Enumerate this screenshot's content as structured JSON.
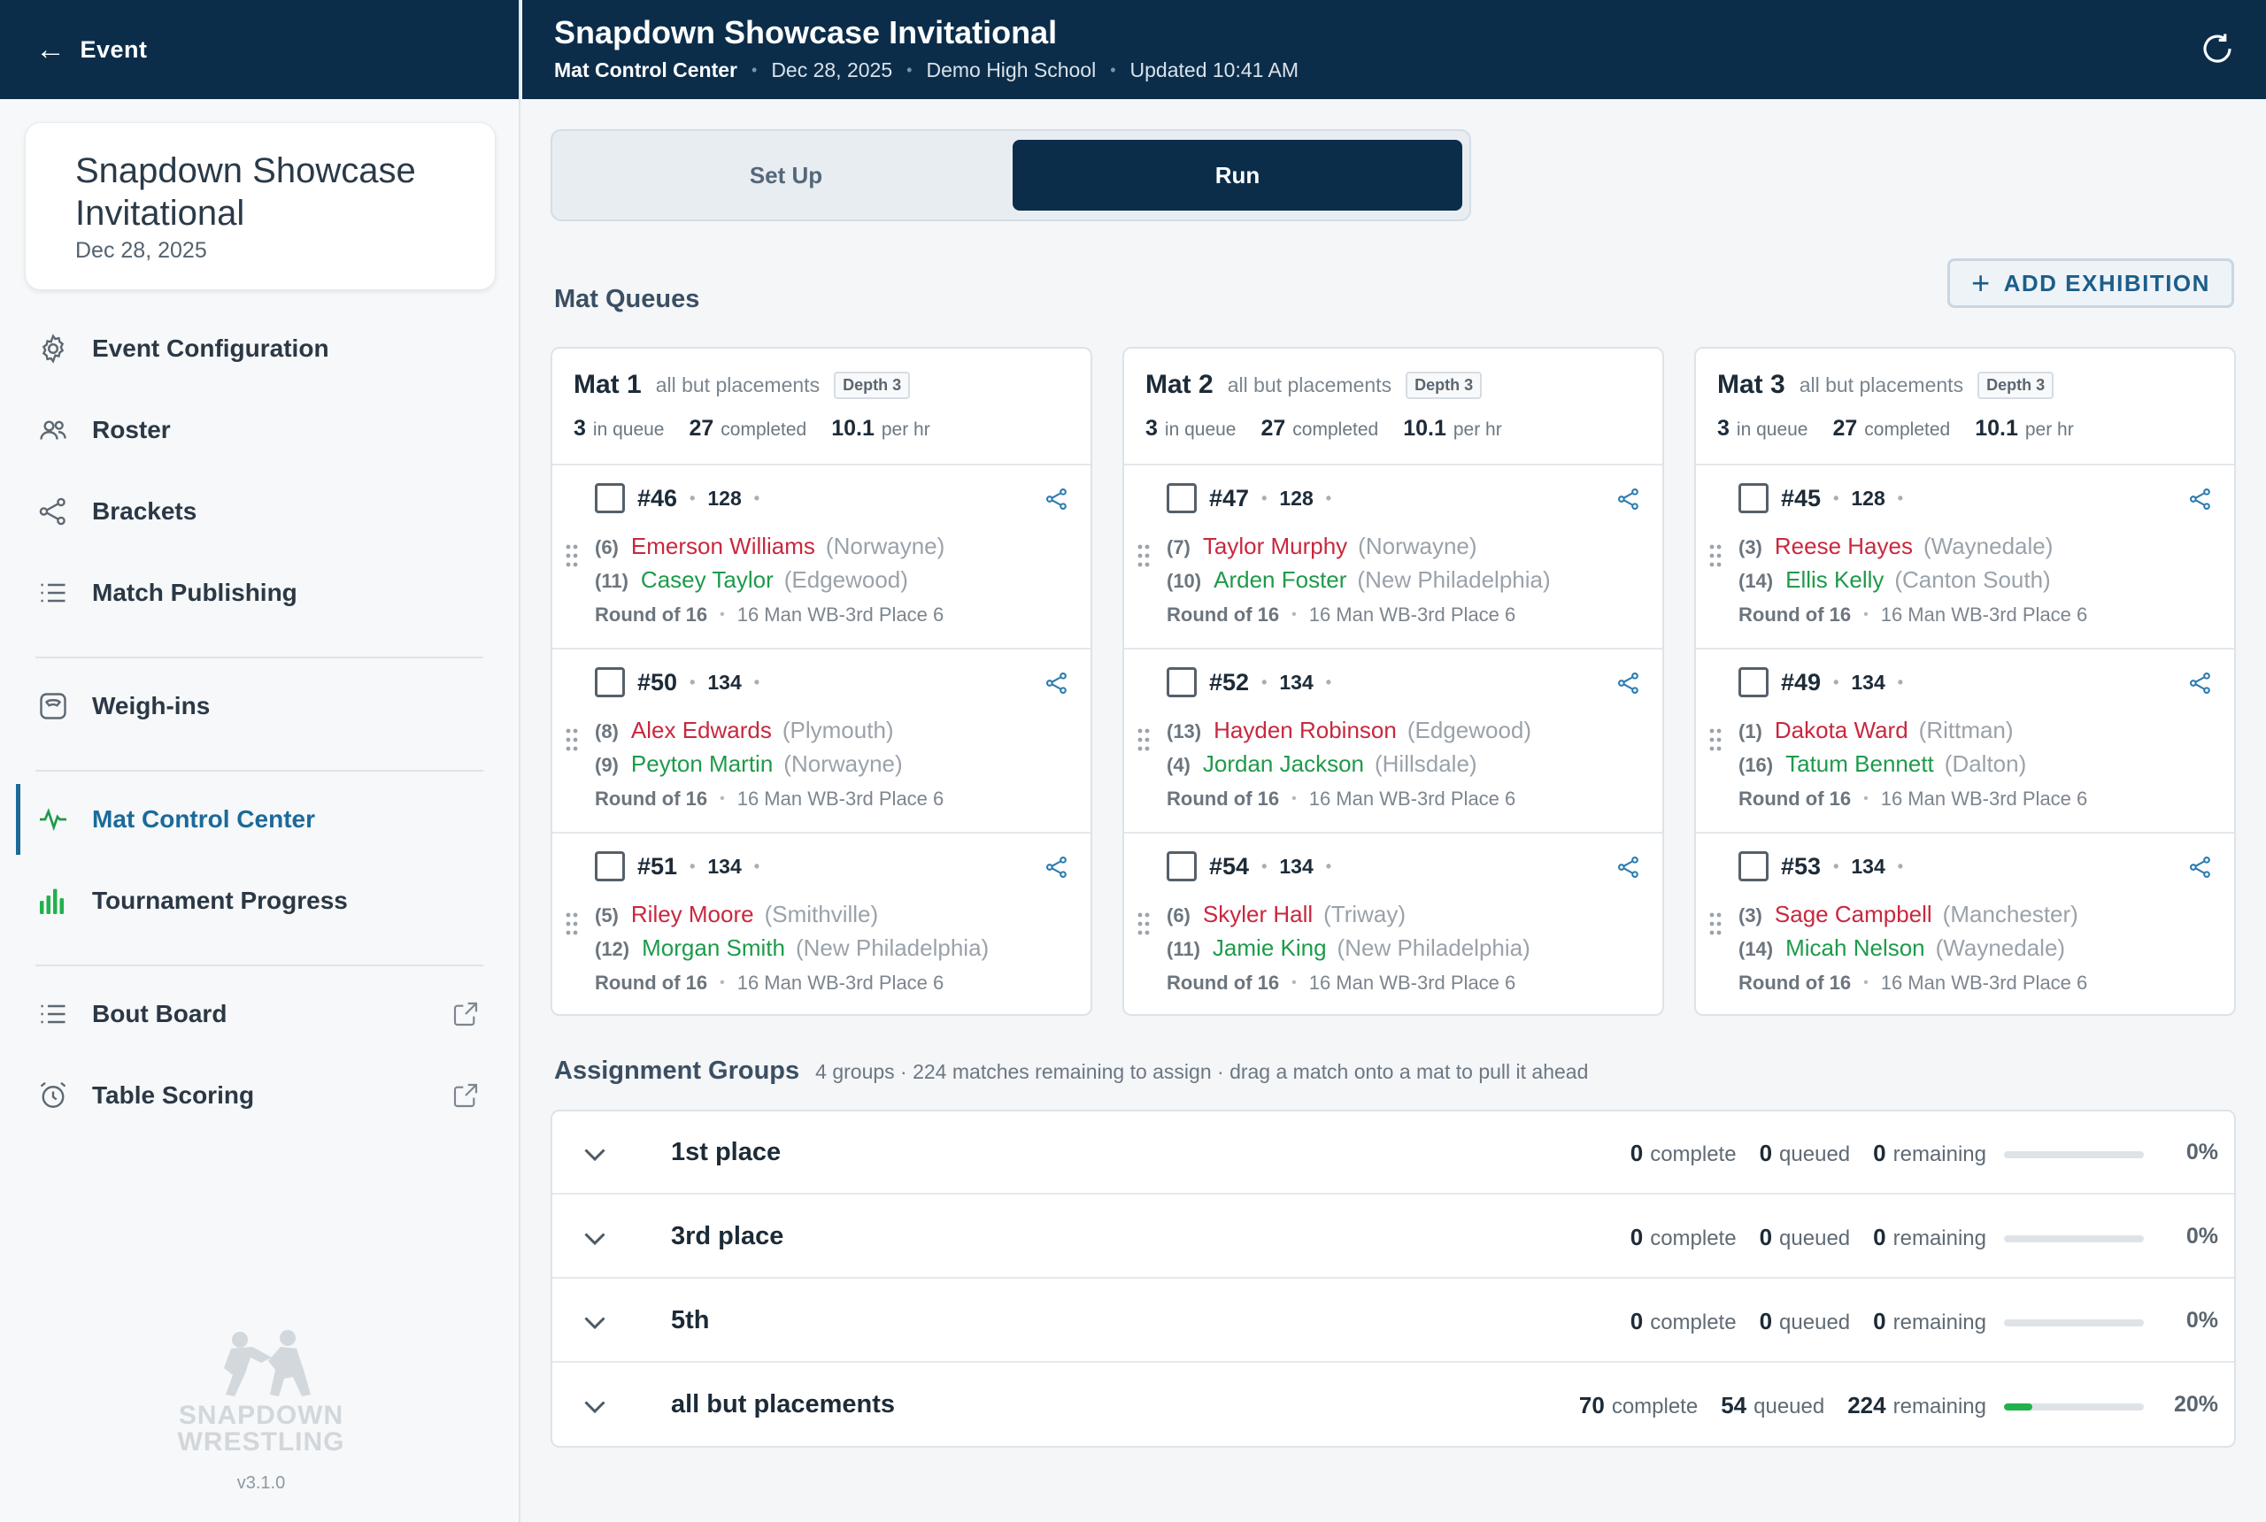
{
  "sidebar": {
    "back_label": "Event",
    "event_card": {
      "title": "Snapdown Showcase Invitational",
      "date": "Dec 28, 2025"
    },
    "items": [
      {
        "label": "Event Configuration",
        "icon": "gear-icon"
      },
      {
        "label": "Roster",
        "icon": "users-icon"
      },
      {
        "label": "Brackets",
        "icon": "share-nodes-icon"
      },
      {
        "label": "Match Publishing",
        "icon": "list-icon"
      },
      {
        "label": "Weigh-ins",
        "icon": "scale-icon"
      },
      {
        "label": "Mat Control Center",
        "icon": "pulse-icon",
        "active": true
      },
      {
        "label": "Tournament Progress",
        "icon": "bar-chart-icon"
      },
      {
        "label": "Bout Board",
        "icon": "list-icon",
        "external": true
      },
      {
        "label": "Table Scoring",
        "icon": "alarm-clock-icon",
        "external": true
      }
    ],
    "logo_line1": "SNAPDOWN",
    "logo_line2": "WRESTLING",
    "version": "v3.1.0"
  },
  "header": {
    "title": "Snapdown Showcase Invitational",
    "crumb": "Mat Control Center",
    "date": "Dec 28, 2025",
    "school": "Demo High School",
    "updated": "Updated 10:41 AM"
  },
  "tabs": {
    "setup": "Set Up",
    "run": "Run",
    "active": "run"
  },
  "mat_queues": {
    "title": "Mat Queues",
    "add_button": "ADD EXHIBITION",
    "labels": {
      "in_queue": "in queue",
      "completed": "completed",
      "per_hr": "per hr"
    },
    "mats": [
      {
        "name": "Mat 1",
        "filter": "all but placements",
        "depth": "Depth 3",
        "in_queue": "3",
        "completed": "27",
        "rate": "10.1",
        "matches": [
          {
            "num": "#46",
            "weight": "128",
            "red": {
              "seed": "(6)",
              "name": "Emerson Williams",
              "team": "(Norwayne)"
            },
            "green": {
              "seed": "(11)",
              "name": "Casey Taylor",
              "team": "(Edgewood)"
            },
            "round": "Round of 16",
            "bracket": "16 Man WB-3rd Place 6"
          },
          {
            "num": "#50",
            "weight": "134",
            "red": {
              "seed": "(8)",
              "name": "Alex Edwards",
              "team": "(Plymouth)"
            },
            "green": {
              "seed": "(9)",
              "name": "Peyton Martin",
              "team": "(Norwayne)"
            },
            "round": "Round of 16",
            "bracket": "16 Man WB-3rd Place 6"
          },
          {
            "num": "#51",
            "weight": "134",
            "red": {
              "seed": "(5)",
              "name": "Riley Moore",
              "team": "(Smithville)"
            },
            "green": {
              "seed": "(12)",
              "name": "Morgan Smith",
              "team": "(New Philadelphia)"
            },
            "round": "Round of 16",
            "bracket": "16 Man WB-3rd Place 6"
          }
        ]
      },
      {
        "name": "Mat 2",
        "filter": "all but placements",
        "depth": "Depth 3",
        "in_queue": "3",
        "completed": "27",
        "rate": "10.1",
        "matches": [
          {
            "num": "#47",
            "weight": "128",
            "red": {
              "seed": "(7)",
              "name": "Taylor Murphy",
              "team": "(Norwayne)"
            },
            "green": {
              "seed": "(10)",
              "name": "Arden Foster",
              "team": "(New Philadelphia)"
            },
            "round": "Round of 16",
            "bracket": "16 Man WB-3rd Place 6"
          },
          {
            "num": "#52",
            "weight": "134",
            "red": {
              "seed": "(13)",
              "name": "Hayden Robinson",
              "team": "(Edgewood)"
            },
            "green": {
              "seed": "(4)",
              "name": "Jordan Jackson",
              "team": "(Hillsdale)"
            },
            "round": "Round of 16",
            "bracket": "16 Man WB-3rd Place 6"
          },
          {
            "num": "#54",
            "weight": "134",
            "red": {
              "seed": "(6)",
              "name": "Skyler Hall",
              "team": "(Triway)"
            },
            "green": {
              "seed": "(11)",
              "name": "Jamie King",
              "team": "(New Philadelphia)"
            },
            "round": "Round of 16",
            "bracket": "16 Man WB-3rd Place 6"
          }
        ]
      },
      {
        "name": "Mat 3",
        "filter": "all but placements",
        "depth": "Depth 3",
        "in_queue": "3",
        "completed": "27",
        "rate": "10.1",
        "matches": [
          {
            "num": "#45",
            "weight": "128",
            "red": {
              "seed": "(3)",
              "name": "Reese Hayes",
              "team": "(Waynedale)"
            },
            "green": {
              "seed": "(14)",
              "name": "Ellis Kelly",
              "team": "(Canton South)"
            },
            "round": "Round of 16",
            "bracket": "16 Man WB-3rd Place 6"
          },
          {
            "num": "#49",
            "weight": "134",
            "red": {
              "seed": "(1)",
              "name": "Dakota Ward",
              "team": "(Rittman)"
            },
            "green": {
              "seed": "(16)",
              "name": "Tatum Bennett",
              "team": "(Dalton)"
            },
            "round": "Round of 16",
            "bracket": "16 Man WB-3rd Place 6"
          },
          {
            "num": "#53",
            "weight": "134",
            "red": {
              "seed": "(3)",
              "name": "Sage Campbell",
              "team": "(Manchester)"
            },
            "green": {
              "seed": "(14)",
              "name": "Micah Nelson",
              "team": "(Waynedale)"
            },
            "round": "Round of 16",
            "bracket": "16 Man WB-3rd Place 6"
          }
        ]
      }
    ]
  },
  "assignment_groups": {
    "title": "Assignment Groups",
    "note": "4 groups · 224 matches remaining to assign · drag a match onto a mat to pull it ahead",
    "labels": {
      "complete": "complete",
      "queued": "queued",
      "remaining": "remaining"
    },
    "groups": [
      {
        "name": "1st place",
        "complete": "0",
        "queued": "0",
        "remaining": "0",
        "progress": 0,
        "pct": "0%"
      },
      {
        "name": "3rd place",
        "complete": "0",
        "queued": "0",
        "remaining": "0",
        "progress": 0,
        "pct": "0%"
      },
      {
        "name": "5th",
        "complete": "0",
        "queued": "0",
        "remaining": "0",
        "progress": 0,
        "pct": "0%"
      },
      {
        "name": "all but placements",
        "complete": "70",
        "queued": "54",
        "remaining": "224",
        "progress": 0.2,
        "pct": "20%"
      }
    ]
  },
  "colors": {
    "navy": "#0b2d4a",
    "accent": "#1b6a9a",
    "red_corner": "#c8283e",
    "green_corner": "#1e9a4a",
    "progress": "#22b14c"
  }
}
